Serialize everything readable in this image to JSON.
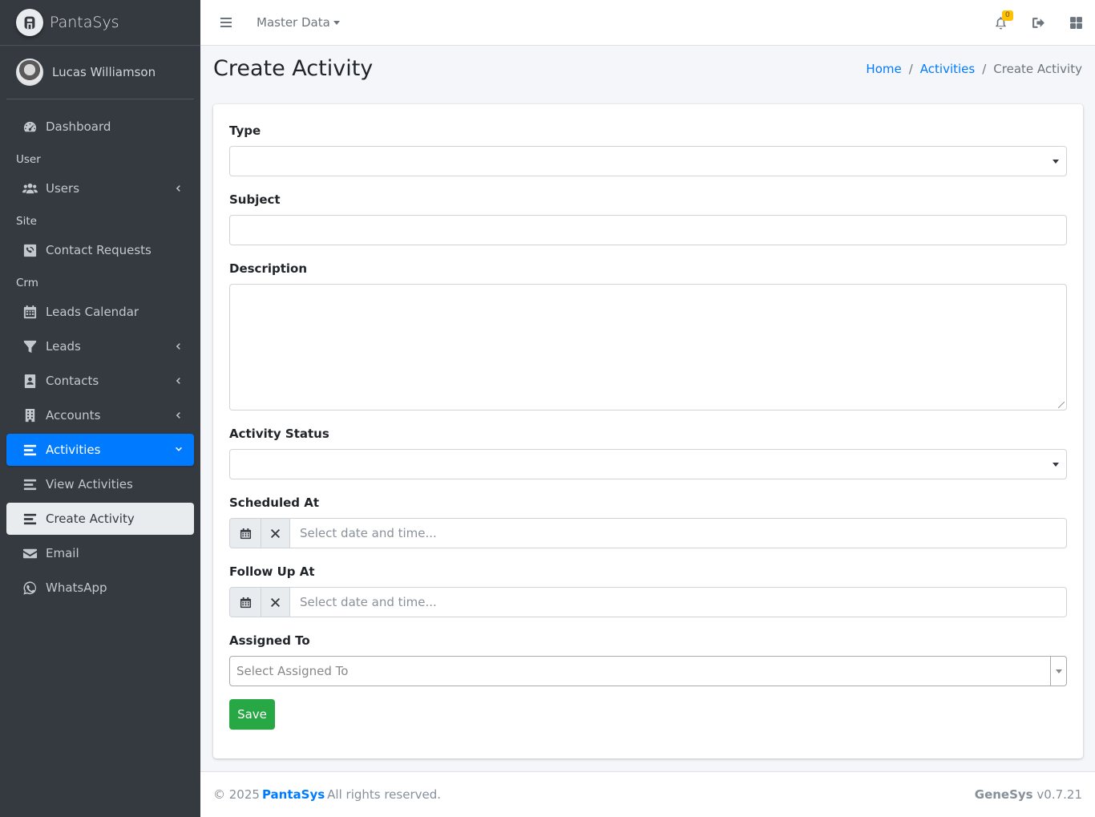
{
  "brand": {
    "name": "PantaSys"
  },
  "user": {
    "name": "Lucas Williamson"
  },
  "sidebar": {
    "items": [
      {
        "type": "item",
        "label": "Dashboard",
        "icon": "dashboard-icon"
      },
      {
        "type": "header",
        "label": "User"
      },
      {
        "type": "item",
        "label": "Users",
        "icon": "users-icon",
        "chevron": "left"
      },
      {
        "type": "header",
        "label": "Site"
      },
      {
        "type": "item",
        "label": "Contact Requests",
        "icon": "contact-requests-icon"
      },
      {
        "type": "header",
        "label": "Crm"
      },
      {
        "type": "item",
        "label": "Leads Calendar",
        "icon": "calendar-icon"
      },
      {
        "type": "item",
        "label": "Leads",
        "icon": "filter-icon",
        "chevron": "left"
      },
      {
        "type": "item",
        "label": "Contacts",
        "icon": "contact-card-icon",
        "chevron": "left"
      },
      {
        "type": "item",
        "label": "Accounts",
        "icon": "building-icon",
        "chevron": "left"
      },
      {
        "type": "item",
        "label": "Activities",
        "icon": "list-icon",
        "chevron": "down",
        "active": true
      },
      {
        "type": "item",
        "label": "View Activities",
        "icon": "list-icon"
      },
      {
        "type": "item",
        "label": "Create Activity",
        "icon": "list-icon",
        "subActive": true
      },
      {
        "type": "item",
        "label": "Email",
        "icon": "envelope-icon"
      },
      {
        "type": "item",
        "label": "WhatsApp",
        "icon": "whatsapp-icon"
      }
    ]
  },
  "topbar": {
    "menu_label": "Master Data",
    "notification_count": "0"
  },
  "page": {
    "title": "Create Activity",
    "breadcrumb": {
      "home": "Home",
      "activities": "Activities",
      "current": "Create Activity"
    }
  },
  "form": {
    "type_label": "Type",
    "subject_label": "Subject",
    "description_label": "Description",
    "status_label": "Activity Status",
    "scheduled_label": "Scheduled At",
    "scheduled_placeholder": "Select date and time...",
    "followup_label": "Follow Up At",
    "followup_placeholder": "Select date and time...",
    "assigned_label": "Assigned To",
    "assigned_placeholder": "Select Assigned To",
    "save_label": "Save"
  },
  "footer": {
    "copyright_prefix": "© 2025",
    "company": "PantaSys",
    "rights": "All rights reserved.",
    "product": "GeneSys",
    "version": "v0.7.21"
  },
  "colors": {
    "sidebar_bg": "#343a40",
    "primary": "#007bff",
    "success": "#28a745",
    "badge": "#ffc107"
  }
}
